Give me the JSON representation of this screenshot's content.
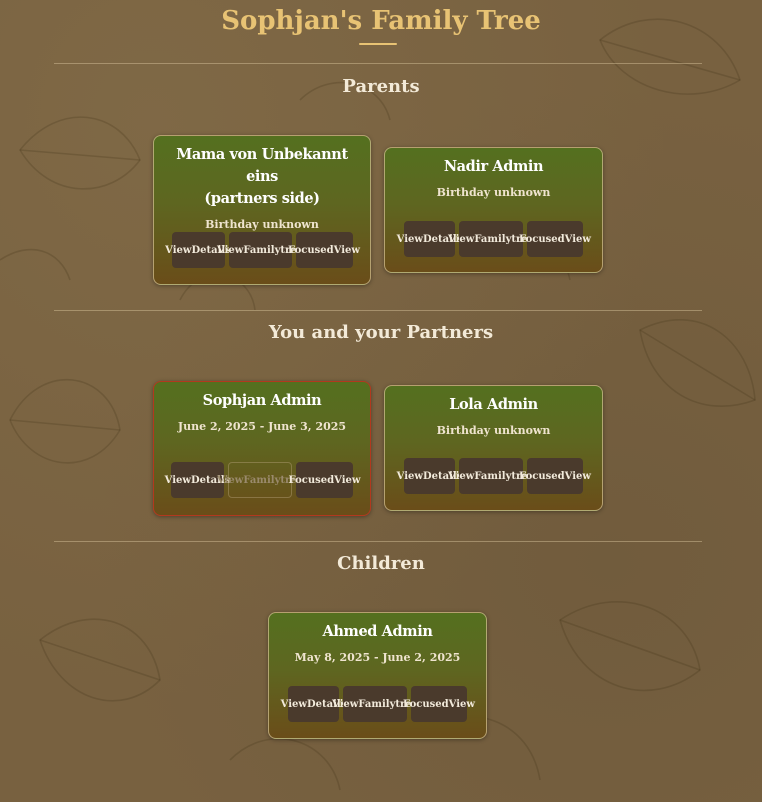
{
  "header": {
    "title": "Sophjan's Family Tree"
  },
  "sections": {
    "parents": {
      "title": "Parents"
    },
    "partners": {
      "title": "You and your Partners"
    },
    "children": {
      "title": "Children"
    }
  },
  "cards": {
    "mama": {
      "name_line1": "Mama von Unbekannt eins",
      "name_line2": "(partners side)",
      "date": "Birthday unknown"
    },
    "nadir": {
      "name": "Nadir Admin",
      "date": "Birthday unknown"
    },
    "sophjan": {
      "name": "Sophjan Admin",
      "date": "June 2, 2025 - June 3, 2025"
    },
    "lola": {
      "name": "Lola Admin",
      "date": "Birthday unknown"
    },
    "ahmed": {
      "name": "Ahmed Admin",
      "date": "May 8, 2025 - June 2, 2025"
    }
  },
  "buttons": {
    "view_details": [
      "View",
      "Details"
    ],
    "view_familytree": [
      "View",
      "Familytree"
    ],
    "focused_view": [
      "Focused",
      "View"
    ]
  },
  "colors": {
    "title": "#e8c374",
    "card_top": "#54701f",
    "card_bottom": "#6a4d19",
    "self_border": "#b2391e",
    "button": "#4a3a2c"
  }
}
